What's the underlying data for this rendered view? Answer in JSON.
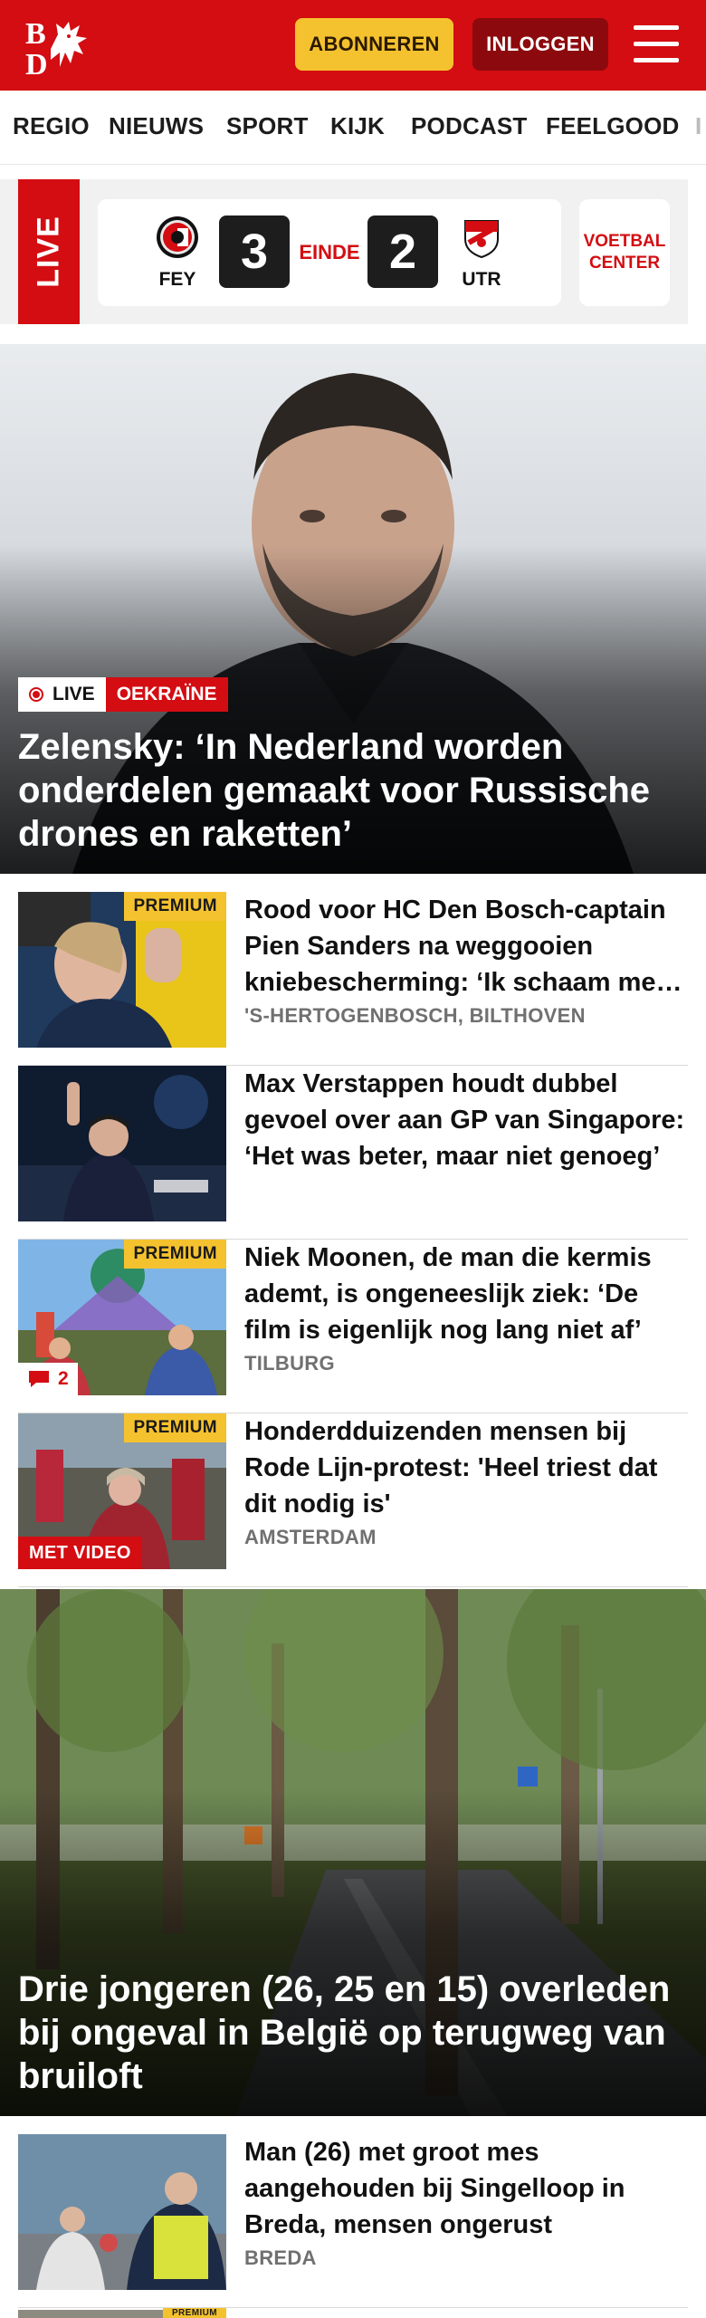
{
  "header": {
    "logo_text": "BD",
    "subscribe_label": "ABONNEREN",
    "login_label": "INLOGGEN",
    "brand_color": "#d30d12"
  },
  "nav": {
    "items": [
      "REGIO",
      "NIEUWS",
      "SPORT",
      "KIJK",
      "PODCAST",
      "FEELGOOD",
      "I"
    ]
  },
  "live_widget": {
    "live_label": "LIVE",
    "home_team": "FEY",
    "home_score": "3",
    "status": "EINDE",
    "away_score": "2",
    "away_team": "UTR",
    "center_label_line1": "VOETBAL",
    "center_label_line2": "CENTER"
  },
  "hero1": {
    "live_tag": "LIVE",
    "category_tag": "OEKRAÏNE",
    "title": "Zelensky: ‘In Nederland worden onderdelen gemaakt voor Russische drones en raketten’"
  },
  "articles": [
    {
      "headline": "Rood voor HC Den Bosch-captain Pien Sanders na weggooien kniebescherming: ‘Ik schaam me diep’",
      "place": "'S-HERTOGENBOSCH, BILTHOVEN",
      "premium": "PREMIUM"
    },
    {
      "headline": "Max Verstappen houdt dubbel gevoel over aan GP van Singapore: ‘Het was beter, maar niet genoeg’",
      "place": ""
    },
    {
      "headline": "Niek Moonen, de man die kermis ademt, is ongeneeslijk ziek: ‘De film is eigenlijk nog lang niet af’",
      "place": "TILBURG",
      "premium": "PREMIUM",
      "comments": "2"
    },
    {
      "headline": "Honderdduizenden mensen bij Rode Lijn-protest: 'Heel triest dat dit nodig is'",
      "place": "AMSTERDAM",
      "premium": "PREMIUM",
      "video": "MET VIDEO"
    }
  ],
  "hero2": {
    "title": "Drie jongeren (26, 25 en 15) overleden bij ongeval in België op terugweg van bruiloft"
  },
  "articles2": [
    {
      "headline": "Man (26) met groot mes aangehouden bij Singelloop in Breda, mensen ongerust",
      "place": "BREDA"
    },
    {
      "premium": "PREMIUM"
    }
  ]
}
